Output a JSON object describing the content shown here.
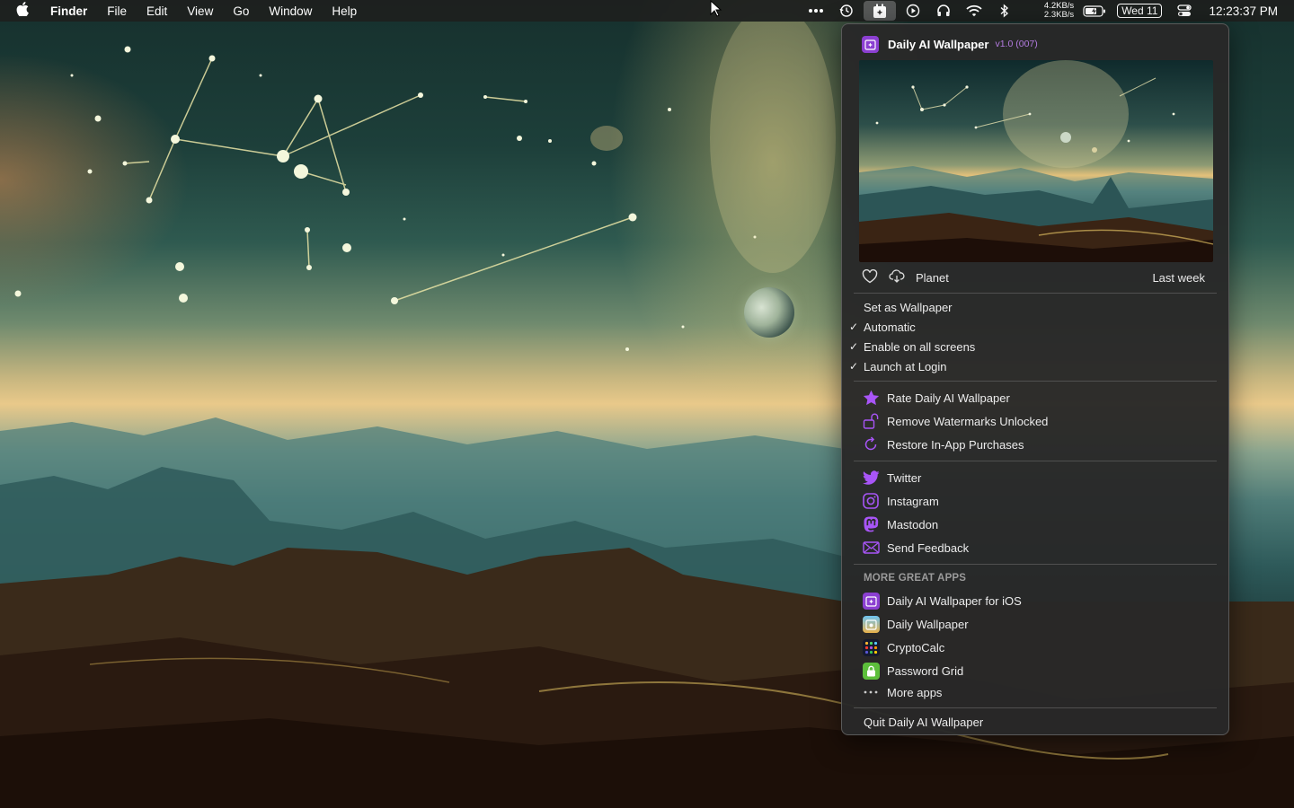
{
  "menubar": {
    "apple": "",
    "app_name": "Finder",
    "menus": [
      "File",
      "Edit",
      "View",
      "Go",
      "Window",
      "Help"
    ],
    "net_up": "4.2KB/s",
    "net_down": "2.3KB/s",
    "date": "Wed 11",
    "time": "12:23:37 PM",
    "icons": [
      "more-icon",
      "time-machine-icon",
      "daily-ai-wallpaper-icon",
      "play-icon",
      "headphones-icon",
      "wifi-icon",
      "bluetooth-icon",
      "battery-icon",
      "control-center-icon"
    ]
  },
  "menu": {
    "title": "Daily AI Wallpaper",
    "version": "v1.0 (007)",
    "category": "Planet",
    "when": "Last week",
    "options": [
      {
        "label": "Set as Wallpaper",
        "checked": false
      },
      {
        "label": "Automatic",
        "checked": true
      },
      {
        "label": "Enable on all screens",
        "checked": true
      },
      {
        "label": "Launch at Login",
        "checked": true
      }
    ],
    "check_mark": "✓",
    "actions": [
      {
        "label": "Rate Daily AI Wallpaper",
        "icon": "star-icon"
      },
      {
        "label": "Remove Watermarks Unlocked",
        "icon": "unlock-icon"
      },
      {
        "label": "Restore In-App Purchases",
        "icon": "restore-icon"
      }
    ],
    "social": [
      {
        "label": "Twitter",
        "icon": "twitter-icon"
      },
      {
        "label": "Instagram",
        "icon": "instagram-icon"
      },
      {
        "label": "Mastodon",
        "icon": "mastodon-icon"
      },
      {
        "label": "Send Feedback",
        "icon": "envelope-icon"
      }
    ],
    "more_apps_label": "MORE GREAT APPS",
    "more_apps": [
      {
        "label": "Daily AI Wallpaper for iOS",
        "icon": "daily-ai-wallpaper-ios-icon"
      },
      {
        "label": "Daily Wallpaper",
        "icon": "daily-wallpaper-icon"
      },
      {
        "label": "CryptoCalc",
        "icon": "cryptocalc-icon"
      },
      {
        "label": "Password Grid",
        "icon": "password-grid-icon"
      },
      {
        "label": "More apps",
        "icon": "ellipsis-icon"
      }
    ],
    "quit": "Quit Daily AI Wallpaper",
    "accent": "#a855f7"
  }
}
